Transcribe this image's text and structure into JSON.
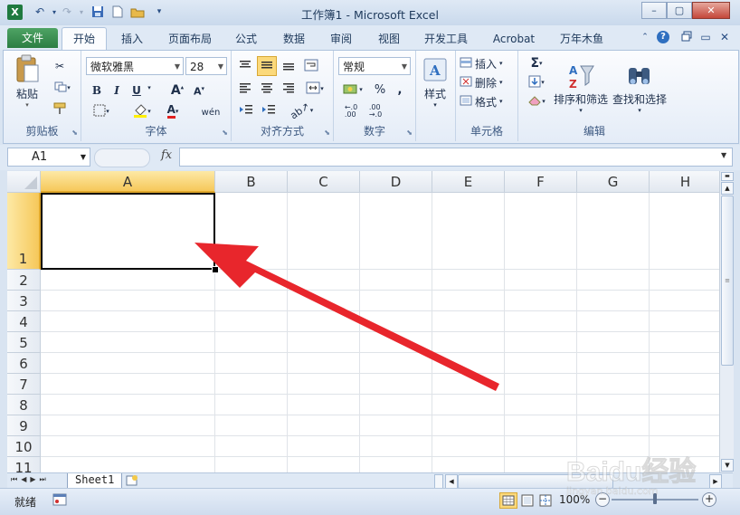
{
  "window": {
    "title": "工作簿1 - Microsoft Excel",
    "minimize": "–",
    "maximize": "▢",
    "close": "✕"
  },
  "tabs": {
    "file": "文件",
    "home": "开始",
    "insert": "插入",
    "page_layout": "页面布局",
    "formulas": "公式",
    "data": "数据",
    "review": "审阅",
    "view": "视图",
    "developer": "开发工具",
    "acrobat": "Acrobat",
    "wannianmuyu": "万年木鱼"
  },
  "ribbon": {
    "clipboard": {
      "paste": "粘贴",
      "label": "剪贴板"
    },
    "font": {
      "name": "微软雅黑",
      "size": "28",
      "bold": "B",
      "italic": "I",
      "underline": "U",
      "label": "字体"
    },
    "alignment": {
      "label": "对齐方式"
    },
    "number": {
      "format": "常规",
      "percent": "%",
      "comma": ",",
      "label": "数字"
    },
    "styles": {
      "button": "样式"
    },
    "cells": {
      "insert": "插入",
      "delete": "删除",
      "format": "格式",
      "label": "单元格"
    },
    "editing": {
      "sort_filter": "排序和筛选",
      "find_select": "查找和选择",
      "label": "编辑"
    }
  },
  "formula_bar": {
    "name_box": "A1",
    "fx": "fx",
    "value": ""
  },
  "grid": {
    "columns": [
      "A",
      "B",
      "C",
      "D",
      "E",
      "F",
      "G",
      "H"
    ],
    "rows": [
      "1",
      "2",
      "3",
      "4",
      "5",
      "6",
      "7",
      "8",
      "9",
      "10",
      "11"
    ],
    "selected_cell": "A1"
  },
  "sheets": [
    "Sheet1"
  ],
  "status": {
    "ready": "就绪",
    "zoom": "100%"
  },
  "watermark": {
    "text": "Baidu经验",
    "url": "jingyan.baidu.com"
  },
  "colors": {
    "file_tab": "#2c7e43",
    "selection": "#f6d778",
    "arrow": "#e8262c"
  }
}
